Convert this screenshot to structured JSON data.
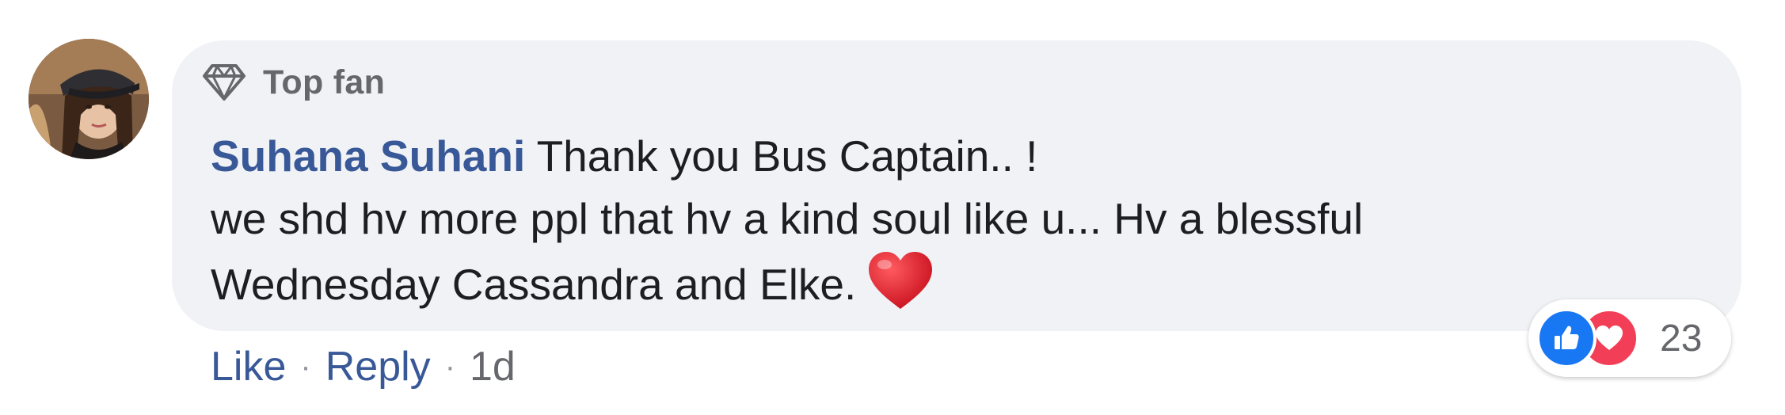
{
  "comment": {
    "badge": {
      "icon": "diamond-icon",
      "label": "Top fan"
    },
    "author": "Suhana Suhani",
    "text_lines": [
      "Thank you Bus Captain.. !",
      "we shd hv more ppl that hv a kind soul like u... Hv a blessful",
      "Wednesday Cassandra and Elke."
    ],
    "emoji": "heart-emoji-icon",
    "actions": {
      "like": "Like",
      "reply": "Reply",
      "separator": "·",
      "timestamp": "1d"
    },
    "reactions": {
      "icons": [
        "like-reaction-icon",
        "love-reaction-icon"
      ],
      "count": "23"
    }
  },
  "colors": {
    "bubble_bg": "#f0f2f5",
    "author": "#385898",
    "text": "#1c1e21",
    "meta": "#65676b",
    "like_blue": "#1877f2",
    "love_red": "#f33e58",
    "heart": "#e0192b"
  }
}
